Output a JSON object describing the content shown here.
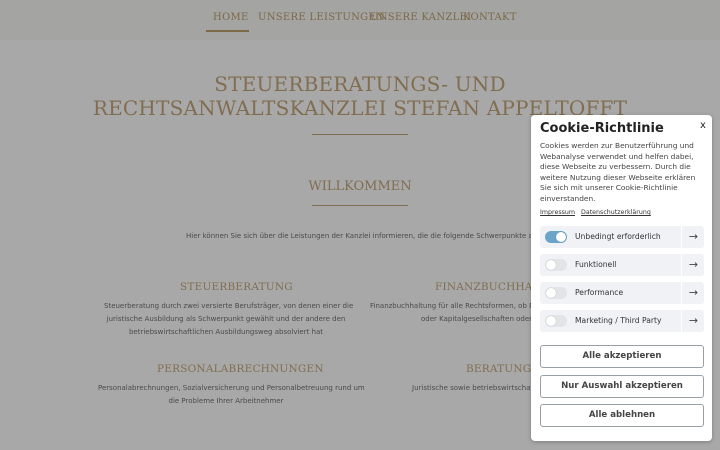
{
  "nav": {
    "items": [
      "HOME",
      "UNSERE LEISTUNGEN",
      "UNSERE KANZLEI",
      "KONTAKT"
    ]
  },
  "hero": {
    "title_line1": "STEUERBERATUNGS- UND",
    "title_line2": "RECHTSANWALTSKANZLEI STEFAN APPELTOFFT"
  },
  "welcome": {
    "heading": "WILLKOMMEN",
    "intro": "Hier können Sie sich über die Leistungen der Kanzlei informieren, die die folgende Schwerpunkte anbietet"
  },
  "services": [
    {
      "title": "STEUERBERATUNG",
      "lines": [
        "Steuerberatung durch zwei versierte Berufsträger, von denen einer die",
        "juristische Ausbildung als Schwerpunkt gewählt  und der andere den",
        "betriebswirtschaftlichen Ausbildungsweg absolviert hat"
      ]
    },
    {
      "title": "FINANZBUCHHALTU",
      "lines": [
        "Finanzbuchhaltung für alle Rechtsformen, ob Einz",
        "oder Kapitalgesellschaften oder a"
      ]
    },
    {
      "title": "PERSONALABRECHNUNGEN",
      "lines": [
        "Personalabrechnungen, Sozialversicherung und Personalbetreuung rund um",
        "die Probleme Ihrer Arbeitnehmer"
      ]
    },
    {
      "title": "BERATUNG",
      "lines": [
        "Juristische sowie betriebswirtschaftl"
      ]
    }
  ],
  "cookie": {
    "title": "Cookie-Richtlinie",
    "close": "x",
    "text": "Cookies werden zur Benutzerführung und Webanalyse verwendet und helfen dabei, diese Webseite zu verbessern. Durch die weitere Nutzung dieser Webseite erklären Sie sich mit unserer Cookie-Richtlinie einverstanden.",
    "links": [
      "Impressum",
      "Datenschutzerklärung"
    ],
    "categories": [
      {
        "label": "Unbedingt erforderlich",
        "enabled": true
      },
      {
        "label": "Funktionell",
        "enabled": false
      },
      {
        "label": "Performance",
        "enabled": false
      },
      {
        "label": "Marketing / Third Party",
        "enabled": false
      }
    ],
    "arrow_glyph": "→",
    "buttons": {
      "accept_all": "Alle akzeptieren",
      "accept_selection": "Nur Auswahl akzeptieren",
      "reject_all": "Alle ablehnen"
    }
  },
  "colors": {
    "gold": "#b3925a",
    "toggle_on": "#6ba4c8"
  }
}
